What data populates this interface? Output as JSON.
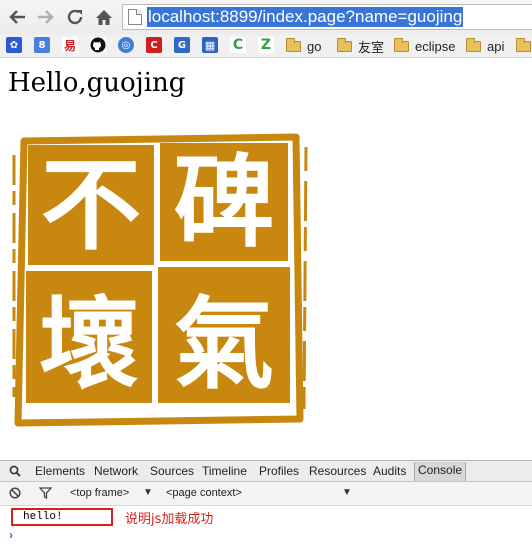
{
  "browser": {
    "url": "localhost:8899/index.page?name=guojing",
    "nav": [
      "back-icon",
      "forward-icon",
      "reload-icon",
      "home-icon"
    ]
  },
  "bookmarks": {
    "icons": [
      {
        "name": "paw-icon",
        "color": "#2a5bd7",
        "glyph": "🐾"
      },
      {
        "name": "google-icon",
        "color": "#4a7fe0",
        "glyph": "8"
      },
      {
        "name": "bookmark-icon-3",
        "color": "#d32020",
        "glyph": "易"
      },
      {
        "name": "github-icon",
        "color": "#111111",
        "glyph": "◉"
      },
      {
        "name": "bookmark-icon-5",
        "color": "#3f7fd6",
        "glyph": "◎"
      },
      {
        "name": "bookmark-icon-6",
        "color": "#cc1f1f",
        "glyph": "C"
      },
      {
        "name": "bookmark-icon-7",
        "color": "#2e6ac6",
        "glyph": "G"
      },
      {
        "name": "bookmark-icon-8",
        "color": "#2b63c4",
        "glyph": "▦"
      },
      {
        "name": "bookmark-icon-9",
        "color": "#2ea043",
        "glyph": "C"
      },
      {
        "name": "bookmark-icon-10",
        "color": "#2ea043",
        "glyph": "Z"
      }
    ],
    "folders": [
      "go",
      "友室",
      "eclipse",
      "api"
    ]
  },
  "page": {
    "greeting": "Hello,guojing",
    "seal": {
      "color": "#c8870f",
      "characters": [
        "不",
        "碑",
        "壞",
        "氣"
      ]
    }
  },
  "devtools": {
    "tabs": [
      "Elements",
      "Network",
      "Sources",
      "Timeline",
      "Profiles",
      "Resources",
      "Audits",
      "Console"
    ],
    "active_tab": "Console",
    "frame_select": "<top frame>",
    "context_select": "<page context>",
    "log_message": "hello!",
    "annotation": "说明js加载成功",
    "annotation_color": "#d81e1e"
  }
}
